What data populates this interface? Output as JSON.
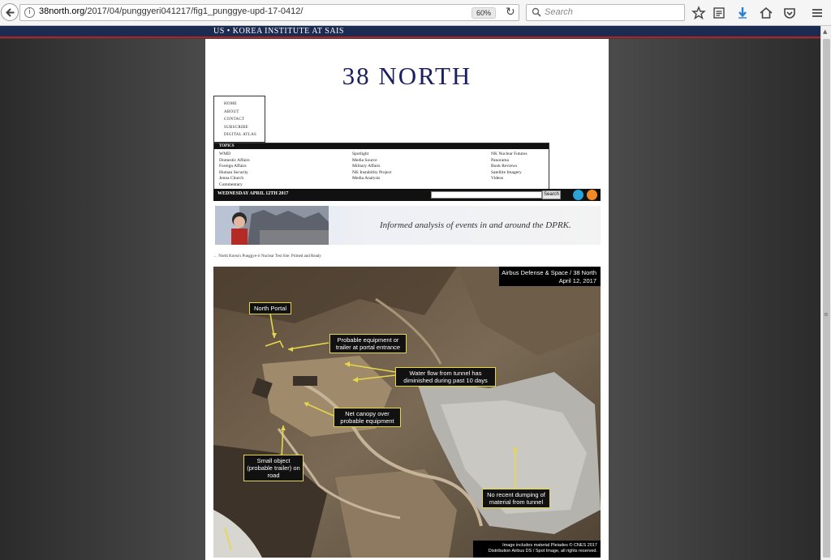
{
  "browser": {
    "url_domain": "38north.org",
    "url_path": "/2017/04/punggyeri041217/fig1_punggye-upd-17-0412/",
    "zoom_label": "60%",
    "search_placeholder": "Search",
    "icons": [
      "back-icon",
      "info-icon",
      "reload-icon",
      "search-icon",
      "star-icon",
      "reading-list-icon",
      "download-icon",
      "home-icon",
      "pocket-icon",
      "menu-icon"
    ]
  },
  "site": {
    "sais_banner": "US • KOREA INSTITUTE AT SAIS",
    "logo": "38 NORTH",
    "nav": [
      "HOME",
      "ABOUT",
      "CONTACT",
      "SUBSCRIBE",
      "DIGITAL ATLAS"
    ],
    "topics_header": "TOPICS",
    "topics_col1": [
      "WMD",
      "Domestic Affairs",
      "Foreign Affairs",
      "Human Security",
      "Jenna Church",
      "Commentary"
    ],
    "topics_col2": [
      "Spotlight",
      "Media Source",
      "Military Affairs",
      "NK Instability Project",
      "Media Analysis"
    ],
    "topics_col3": [
      "NK Nuclear Futures",
      "Panorama",
      "Book Reviews",
      "Satellite Imagery",
      "Videos"
    ],
    "date": "WEDNESDAY APRIL 12TH 2017",
    "search_button": "Search",
    "banner_tagline": "Informed analysis of events in and around the DPRK.",
    "breadcrumb": "← North Korea's Punggye-ri Nuclear Test Site: Primed and Ready"
  },
  "satellite_image": {
    "credit_line1": "Airbus Defense & Space / 38 North",
    "credit_line2": "April 12, 2017",
    "callouts": [
      {
        "text": "North Portal"
      },
      {
        "text": "Probable equipment or trailer at portal entrance"
      },
      {
        "text": "Water flow from tunnel has diminished during past 10 days"
      },
      {
        "text": "Net canopy over probable equipment"
      },
      {
        "text": "Small object (probable trailer) on road"
      },
      {
        "text": "No recent dumping of material from tunnel"
      }
    ],
    "footer_line1": "Image includes material Pleiades © CNES 2017",
    "footer_line2": "Distribution Airbus DS / Spot Image, all rights reserved."
  }
}
